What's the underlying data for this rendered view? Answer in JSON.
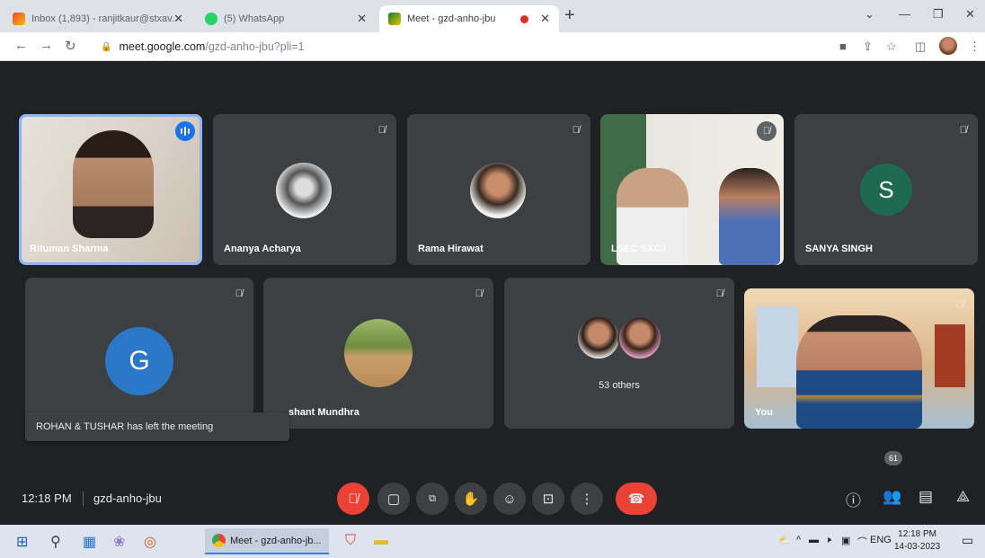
{
  "browser": {
    "tabs": [
      {
        "title": "Inbox (1,893) - ranjitkaur@stxav...",
        "icon": "gmail-icon"
      },
      {
        "title": "(5) WhatsApp",
        "icon": "whatsapp-icon"
      },
      {
        "title": "Meet - gzd-anho-jbu",
        "icon": "meet-icon"
      }
    ],
    "url_domain": "meet.google.com",
    "url_path": "/gzd-anho-jbu?pli=1"
  },
  "meet": {
    "participants": [
      {
        "name": "Rituman Sharma",
        "muted": false,
        "speaking": true
      },
      {
        "name": "Ananya Acharya",
        "muted": true
      },
      {
        "name": "Rama Hirawat",
        "muted": true
      },
      {
        "name": "LSEC SXCJ",
        "muted": true
      },
      {
        "name": "SANYA SINGH",
        "muted": true,
        "initial": "S",
        "avatar_color": "#1e6a50"
      },
      {
        "name": "",
        "muted": true,
        "initial": "G",
        "avatar_color": "#2b78c8"
      },
      {
        "name": "shant Mundhra",
        "muted": true
      },
      {
        "name": "53 others",
        "muted": true
      },
      {
        "name": "You",
        "muted": true
      }
    ],
    "toast": "ROHAN & TUSHAR has left the meeting",
    "time": "12:18 PM",
    "meeting_code": "gzd-anho-jbu",
    "participant_count": "61"
  },
  "taskbar": {
    "task_label": "Meet - gzd-anho-jb...",
    "language": "ENG",
    "time": "12:18 PM",
    "date": "14-03-2023"
  },
  "colors": {
    "stage": "#202124",
    "tile": "#3c4043",
    "leave": "#ea4335",
    "speaking_outline": "#8ab4f8"
  }
}
